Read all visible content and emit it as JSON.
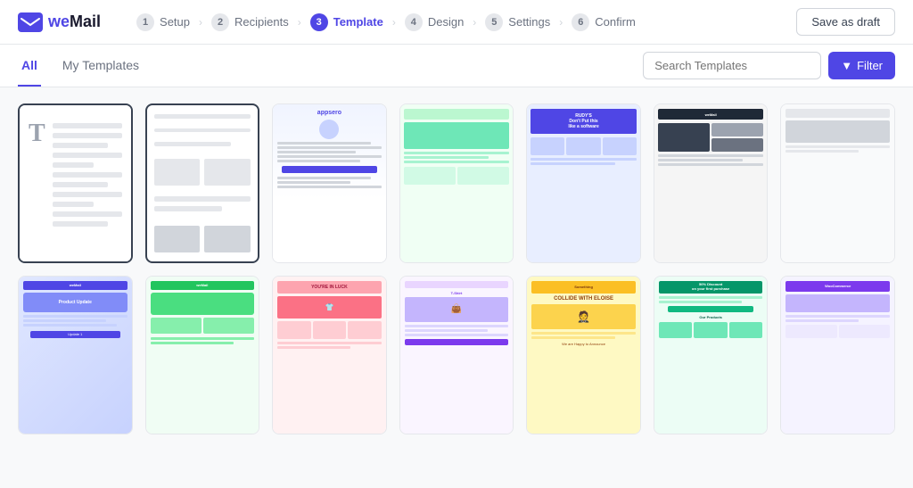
{
  "logo": {
    "text_start": "we",
    "text_end": "Mail"
  },
  "header": {
    "steps": [
      {
        "num": "1",
        "label": "Setup",
        "active": false
      },
      {
        "num": "2",
        "label": "Recipients",
        "active": false
      },
      {
        "num": "3",
        "label": "Template",
        "active": true
      },
      {
        "num": "4",
        "label": "Design",
        "active": false
      },
      {
        "num": "5",
        "label": "Settings",
        "active": false
      },
      {
        "num": "6",
        "label": "Confirm",
        "active": false
      }
    ],
    "save_draft": "Save as draft"
  },
  "tabs": {
    "all_label": "All",
    "my_templates_label": "My Templates"
  },
  "search": {
    "placeholder": "Search Templates"
  },
  "filter_btn": "Filter",
  "templates": [
    {
      "id": 1,
      "type": "blank-text",
      "selected": true
    },
    {
      "id": 2,
      "type": "blank-grid",
      "selected": true
    },
    {
      "id": 3,
      "type": "appsero"
    },
    {
      "id": 4,
      "type": "green-food"
    },
    {
      "id": 5,
      "type": "rudys"
    },
    {
      "id": 6,
      "type": "watch"
    },
    {
      "id": 7,
      "type": "purple-product"
    },
    {
      "id": 8,
      "type": "green2"
    },
    {
      "id": 9,
      "type": "pink-wear"
    },
    {
      "id": 10,
      "type": "tshirt"
    },
    {
      "id": 11,
      "type": "yellow-collide"
    },
    {
      "id": 12,
      "type": "green-discount"
    },
    {
      "id": 13,
      "type": "extra1"
    },
    {
      "id": 14,
      "type": "extra2"
    }
  ]
}
